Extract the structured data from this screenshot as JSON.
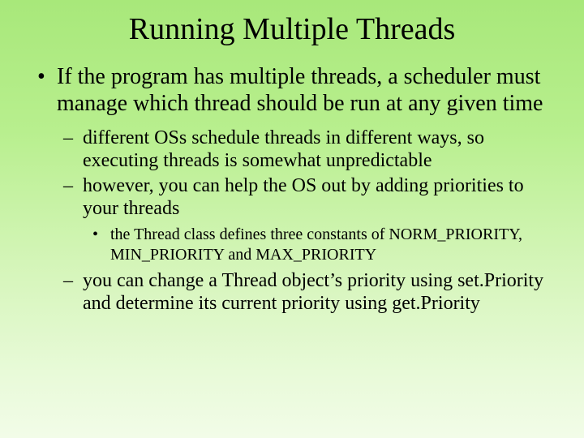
{
  "title": "Running Multiple Threads",
  "bullets": {
    "main": {
      "text": "If the program has multiple threads, a scheduler must manage which thread should be run at any given time"
    },
    "sub1": {
      "text": "different OSs schedule threads in different ways, so executing threads is somewhat unpredictable"
    },
    "sub2": {
      "text": "however, you can help the OS out by adding priorities to your threads"
    },
    "subsub": {
      "text": "the Thread class defines three constants of NORM_PRIORITY, MIN_PRIORITY and MAX_PRIORITY"
    },
    "sub3": {
      "text": "you can change a Thread object’s priority using set.Priority and determine its current priority using get.Priority"
    }
  }
}
